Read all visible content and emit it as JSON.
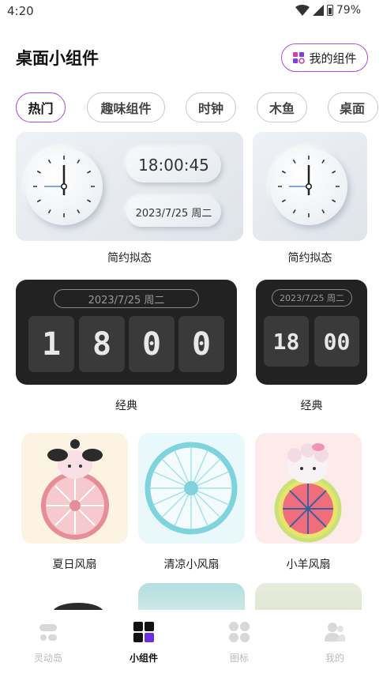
{
  "status_bar": {
    "time": "4:20",
    "battery": "79%"
  },
  "header": {
    "title": "桌面小组件",
    "my_widgets_label": "我的组件"
  },
  "tabs": [
    {
      "label": "热门",
      "active": true
    },
    {
      "label": "趣味组件",
      "active": false
    },
    {
      "label": "时钟",
      "active": false
    },
    {
      "label": "木鱼",
      "active": false
    },
    {
      "label": "桌面",
      "active": false
    }
  ],
  "widgets": {
    "simple_large": {
      "time": "18:00:45",
      "date": "2023/7/25 周二",
      "caption": "简约拟态"
    },
    "simple_small": {
      "caption": "简约拟态"
    },
    "classic_large": {
      "date": "2023/7/25 周二",
      "digits": [
        "1",
        "8",
        "0",
        "0"
      ],
      "caption": "经典"
    },
    "classic_small": {
      "date": "2023/7/25 周二",
      "digits": [
        "18",
        "00"
      ],
      "caption": "经典"
    },
    "fans": [
      {
        "caption": "夏日风扇",
        "bg": "#fdf3e3"
      },
      {
        "caption": "清凉小风扇",
        "bg": "#e9f8fb"
      },
      {
        "caption": "小羊风扇",
        "bg": "#fdebec"
      }
    ]
  },
  "bottom_nav": [
    {
      "label": "灵动岛",
      "active": false,
      "icon": "island-icon"
    },
    {
      "label": "小组件",
      "active": true,
      "icon": "widgets-icon"
    },
    {
      "label": "图标",
      "active": false,
      "icon": "icons-grid-icon"
    },
    {
      "label": "我的",
      "active": false,
      "icon": "profile-icon"
    }
  ],
  "colors": {
    "accent": "#a44be0",
    "dark_card": "#222222"
  }
}
